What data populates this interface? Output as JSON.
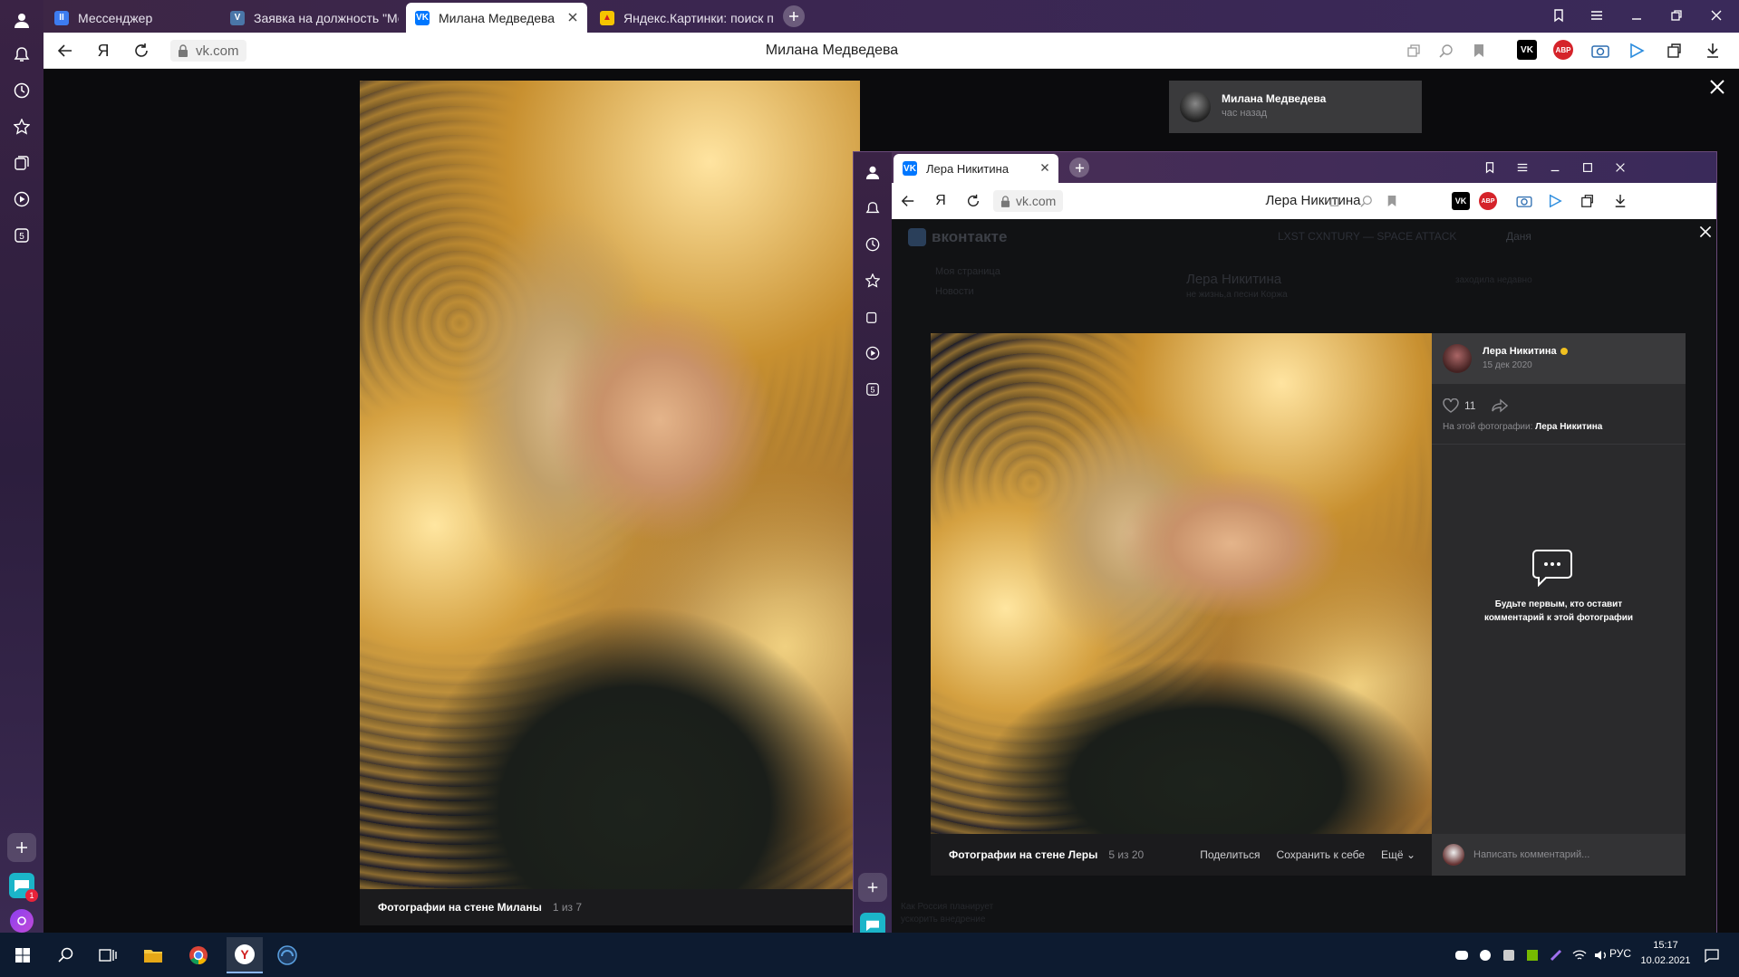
{
  "main_browser": {
    "tabs": [
      {
        "label": "Мессенджер",
        "favicon": "messenger-icon",
        "color": "#3d7cf0"
      },
      {
        "label": "Заявка на должность \"Мо",
        "favicon": "vk-icon",
        "color": "#4a76a8"
      },
      {
        "label": "Милана Медведева",
        "favicon": "vk-icon",
        "color": "#0077ff"
      },
      {
        "label": "Яндекс.Картинки: поиск п",
        "favicon": "images-icon",
        "color": "#f5c400"
      }
    ],
    "url": "vk.com",
    "page_title": "Милана Медведева",
    "photo_caption": "Фотографии на стене Миланы",
    "photo_counter": "1 из 7",
    "author_name": "Милана Медведева",
    "author_time": "час назад",
    "abp_badge": "ABP"
  },
  "inner_browser": {
    "tab_label": "Лера Никитина",
    "url": "vk.com",
    "page_title": "Лера Никитина",
    "vk_logo_text": "вконтакте",
    "music_track": "LXST CXNTURY — SPACE ATTACK",
    "user_name": "Даня",
    "bg_profile_name": "Лера Никитина",
    "bg_profile_status": "не жизнь,а песни Коржа",
    "bg_profile_seen": "заходила недавно",
    "bg_nav": [
      "Моя страница",
      "Новости"
    ],
    "bg_news": [
      "Как Россия планирует",
      "ускорить внедрение"
    ],
    "photo": {
      "author": "Лера Никитина",
      "date": "15 дек 2020",
      "likes": "11",
      "on_photo_label": "На этой фотографии:",
      "on_photo_name": "Лера Никитина",
      "empty_comments_line1": "Будьте первым, кто оставит",
      "empty_comments_line2": "комментарий к этой фотографии",
      "comment_placeholder": "Написать комментарий...",
      "caption": "Фотографии на стене Леры",
      "counter": "5 из 20",
      "actions": [
        "Поделиться",
        "Сохранить к себе",
        "Ещё"
      ]
    },
    "abp_badge": "ABP"
  },
  "taskbar": {
    "lang": "РУС",
    "time": "15:17",
    "date": "10.02.2021"
  },
  "sidebar_badge": "1",
  "colors": {
    "accent": "#5a3a70",
    "vk_blue": "#0077ff",
    "abp_red": "#d5232a"
  }
}
